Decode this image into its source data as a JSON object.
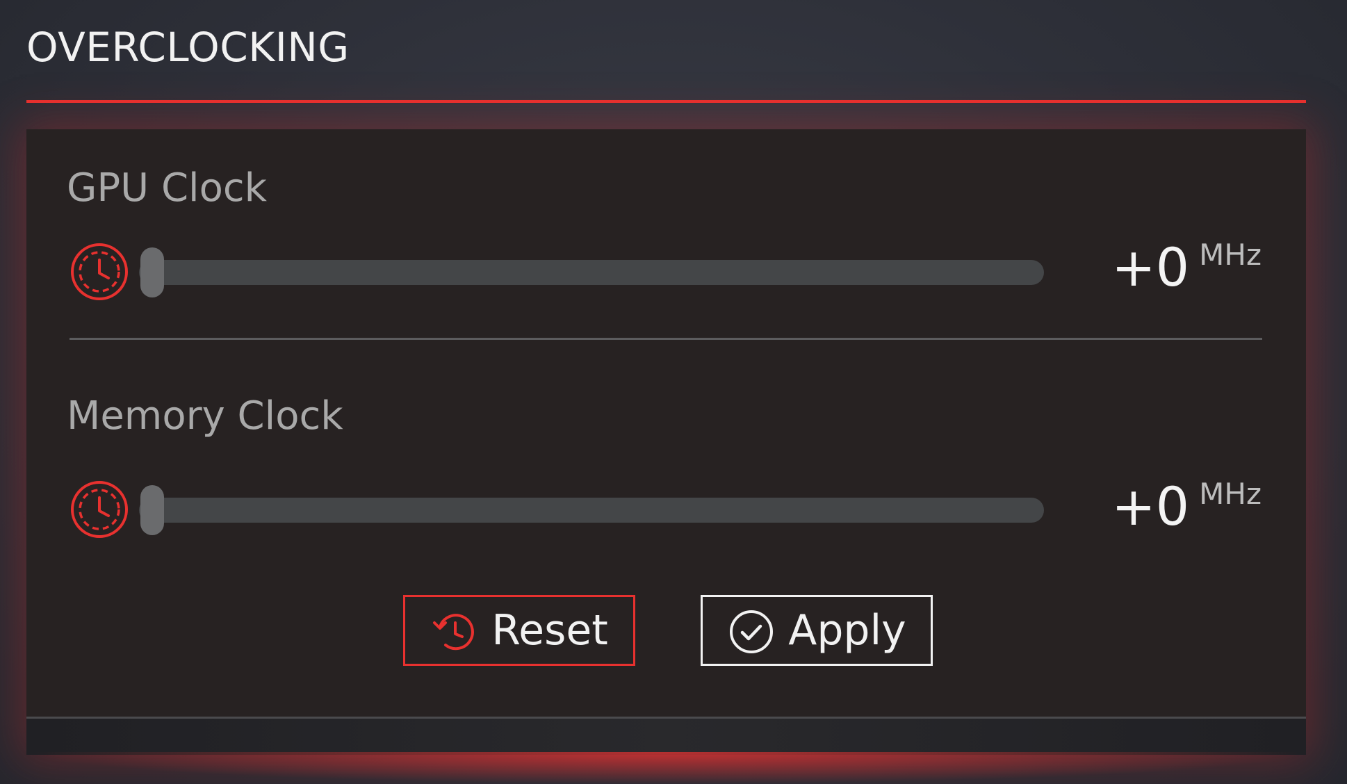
{
  "section": {
    "title": "OVERCLOCKING"
  },
  "gpu_clock": {
    "label": "GPU Clock",
    "value": "+0",
    "unit": "MHz",
    "slider_fraction": 0.0,
    "icon": "clock-icon"
  },
  "memory_clock": {
    "label": "Memory Clock",
    "value": "+0",
    "unit": "MHz",
    "slider_fraction": 0.0,
    "icon": "clock-icon"
  },
  "buttons": {
    "reset_label": "Reset",
    "reset_icon": "reset-icon",
    "apply_label": "Apply",
    "apply_icon": "check-circle-icon"
  },
  "colors": {
    "accent": "#e8312f",
    "panel": "#272222",
    "track": "#444648",
    "thumb": "#6a6b6d"
  }
}
